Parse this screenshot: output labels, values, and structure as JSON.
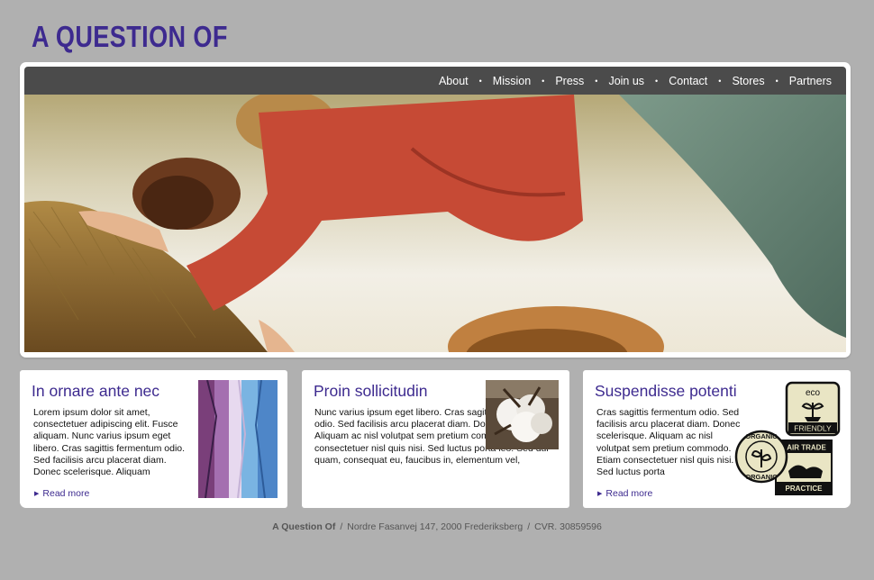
{
  "brand": {
    "logo_text": "A QUESTION OF"
  },
  "nav": {
    "items": [
      {
        "label": "About"
      },
      {
        "label": "Mission"
      },
      {
        "label": "Press"
      },
      {
        "label": "Join us"
      },
      {
        "label": "Contact"
      },
      {
        "label": "Stores"
      },
      {
        "label": "Partners"
      }
    ],
    "separator": "•"
  },
  "cards": [
    {
      "title": "In ornare ante nec",
      "body": "Lorem ipsum dolor sit amet, consectetuer adipiscing elit. Fusce aliquam. Nunc varius ipsum eget libero. Cras sagittis fermentum odio. Sed facilisis arcu placerat diam. Donec scelerisque. Aliquam",
      "link": "Read more"
    },
    {
      "title": "Proin sollicitudin",
      "body": "Nunc varius ipsum eget libero. Cras sagittis fermentum odio. Sed facilisis arcu placerat diam. Donec scelerisque. Aliquam ac nisl volutpat sem pretium commodo. Etiam consectetuer nisl quis nisi. Sed luctus porta leo. Sed dui quam, consequat eu, faucibus in, elementum vel,"
    },
    {
      "title": "Suspendisse potenti",
      "body": "Cras sagittis fermentum odio. Sed facilisis arcu placerat diam.  Donec scelerisque. Aliquam ac nisl volutpat sem pretium commodo. Etiam consectetuer nisl quis nisi. Sed luctus porta",
      "link": "Read more",
      "badges": {
        "eco": [
          "eco",
          "FRIENDLY"
        ],
        "organic": "ORGANIC",
        "fairtrade": [
          "FAIR TRADE",
          "PRACTICE"
        ]
      }
    }
  ],
  "footer": {
    "company": "A Question Of",
    "address": "Nordre Fasanvej 147, 2000 Frederiksberg",
    "cvr": "CVR. 30859596",
    "separator": "/"
  },
  "colors": {
    "brand": "#3d2a8f",
    "background": "#b0b0b0",
    "navbar": "#4b4b4b"
  },
  "icons": [
    "bullet-arrow-icon",
    "eco-friendly-badge",
    "organic-badge",
    "fair-trade-badge"
  ]
}
